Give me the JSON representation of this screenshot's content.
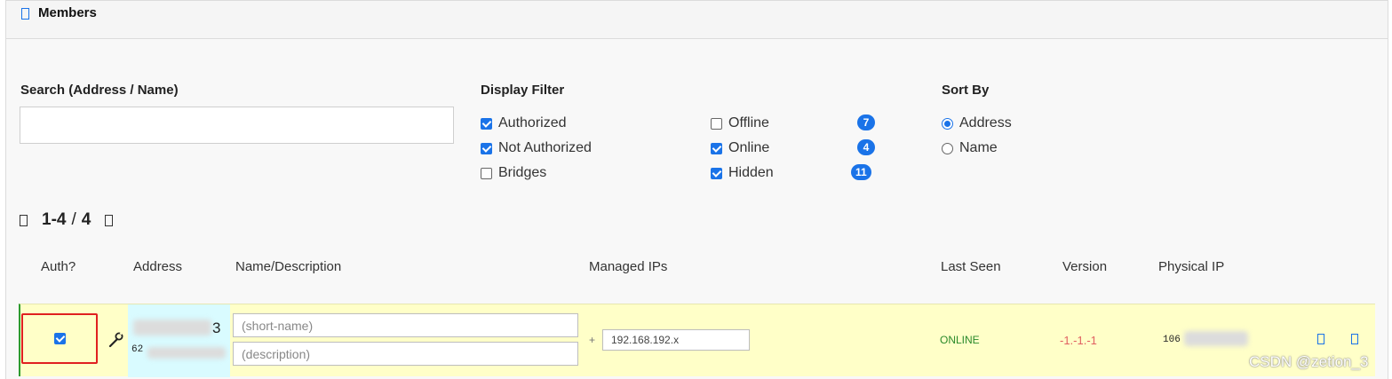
{
  "panel": {
    "title": "Members"
  },
  "search": {
    "label": "Search (Address / Name)",
    "placeholder": "",
    "value": ""
  },
  "display_filter": {
    "label": "Display Filter",
    "left_options": [
      {
        "label": "Authorized",
        "checked": true
      },
      {
        "label": "Not Authorized",
        "checked": true
      },
      {
        "label": "Bridges",
        "checked": false
      }
    ],
    "right_options": [
      {
        "label": "Offline",
        "checked": false,
        "count": "7"
      },
      {
        "label": "Online",
        "checked": true,
        "count": "4"
      },
      {
        "label": "Hidden",
        "checked": true,
        "count": "11"
      }
    ]
  },
  "sort_by": {
    "label": "Sort By",
    "options": [
      {
        "label": "Address",
        "selected": true
      },
      {
        "label": "Name",
        "selected": false
      }
    ]
  },
  "pager": {
    "range": "1-4",
    "separator": "/",
    "total": "4"
  },
  "table": {
    "headers": {
      "auth": "Auth?",
      "address": "Address",
      "name_desc": "Name/Description",
      "managed_ips": "Managed IPs",
      "last_seen": "Last Seen",
      "version": "Version",
      "physical_ip": "Physical IP"
    },
    "rows": [
      {
        "authorized": true,
        "address_suffix": "3",
        "address_prefix": "62",
        "name_placeholder": "(short-name)",
        "description_placeholder": "(description)",
        "managed_ip_prefix": "+",
        "managed_ip": "192.168.192.x",
        "last_seen": "ONLINE",
        "version": "-1.-1.-1",
        "physical_ip_prefix": "106"
      }
    ]
  },
  "watermark": "CSDN @zetion_3",
  "colors": {
    "accent": "#1a73e8",
    "row_bg": "#ffffc8",
    "address_bg": "#d9fbff",
    "online": "#2a8a2a",
    "version": "#e06060",
    "highlight_box": "#e02020"
  },
  "icons": [
    "members-icon",
    "page-prev-icon",
    "page-next-icon",
    "wrench-icon",
    "member-action-icon",
    "member-delete-icon"
  ]
}
